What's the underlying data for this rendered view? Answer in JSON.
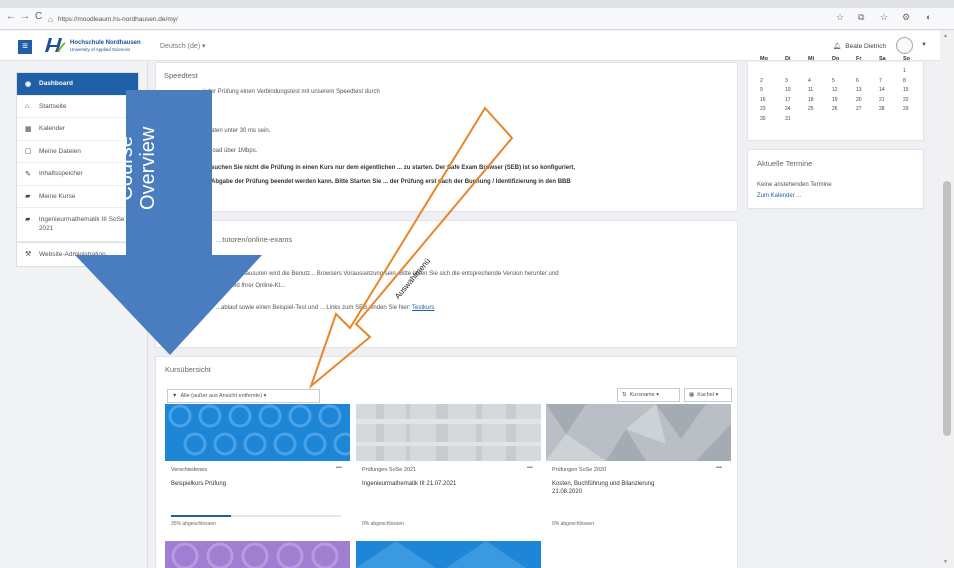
{
  "browser": {
    "url": "https://moodleaum.hs-nordhausen.de/my/"
  },
  "navbar": {
    "brand_line1": "Hochschule Nordhausen",
    "brand_line2": "University of Applied Sciences",
    "language": "Deutsch (de) ▾",
    "user_name": "Beate Dietrich"
  },
  "drawer": {
    "items": [
      {
        "label": "Dashboard",
        "icon": "dashboard-icon"
      },
      {
        "label": "Startseite",
        "icon": "home-icon"
      },
      {
        "label": "Kalender",
        "icon": "calendar-icon"
      },
      {
        "label": "Meine Dateien",
        "icon": "file-icon"
      },
      {
        "label": "Inhaltsspeicher",
        "icon": "pencil-icon"
      },
      {
        "label": "Meine Kurse",
        "icon": "graduation-cap-icon"
      },
      {
        "label": "Ingenieurmathematik III SoSe 2021",
        "icon": "graduation-cap-icon"
      }
    ],
    "admin_item": "Website-Administration"
  },
  "speedtest": {
    "title": "Speedtest",
    "line1": "... jeder Prüfung einen Verbindungstest mit unserem Speedtest durch",
    "line2": "...aten unter 30 ms sein.",
    "line3": "...load über 1Mbps.",
    "warn1": "...suchen Sie nicht die Prüfung in einen Kurs nur dem eigentlichen ... zu starten. Der Safe Exam Browser (SEB) ist so konfiguriert,",
    "warn2": "...Abgabe der Prüfung beendet werden kann. Bitte Starten Sie ... der Prüfung erst nach der Buchung / Identifizierung in den BBB"
  },
  "exams": {
    "title": "...tutoren/online-exams",
    "line1": "...Online-Klausuren wird die Benutz... Browsers Voraussetzung sein. Bitte laden Sie sich die entsprechende Version herunter und",
    "line2": "...Vorfeld Ihrer Online-Kl...",
    "line3": "...ablauf sowie einen Beispiel-Test und ... Links zum SEB, finden Sie hier:",
    "link": "Testkurs"
  },
  "calendar": {
    "headers": [
      "Mo",
      "Di",
      "Mi",
      "Do",
      "Fr",
      "Sa",
      "So"
    ],
    "rows": [
      [
        "",
        "",
        "",
        "",
        "",
        "",
        "1"
      ],
      [
        "2",
        "3",
        "4",
        "5",
        "6",
        "7",
        "8"
      ],
      [
        "9",
        "10",
        "11",
        "12",
        "13",
        "14",
        "15"
      ],
      [
        "16",
        "17",
        "18",
        "19",
        "20",
        "21",
        "22"
      ],
      [
        "23",
        "24",
        "25",
        "26",
        "27",
        "28",
        "29"
      ],
      [
        "30",
        "31",
        "",
        "",
        "",
        "",
        ""
      ]
    ]
  },
  "upcoming": {
    "title": "Aktuelle Termine",
    "empty": "Keine anstehenden Termine",
    "link": "Zum Kalender ..."
  },
  "overview": {
    "title": "Kursübersicht",
    "filter": "Alle (außer aus Ansicht entfernte) ▾",
    "sort": "Kursname ▾",
    "view": "Kachel ▾",
    "courses": [
      {
        "category": "Verschiedenes",
        "name": "Beispielkurs Prüfung",
        "progress_text": "35% abgeschlossen",
        "progress": 0.35,
        "color": "#1e86d6"
      },
      {
        "category": "Prüfungen SoSe 2021",
        "name": "Ingenieurmathematik III 21.07.2021",
        "progress_text": "0% abgeschlossen",
        "progress": 0,
        "color": "#d5d8dc"
      },
      {
        "category": "Prüfungen SoSe 2020",
        "name": "Kosten, Buchführung und Bilanzierung 21.08.2020",
        "progress_text": "0% abgeschlossen",
        "progress": 0,
        "color": "#b9bfc5"
      }
    ]
  },
  "annotations": {
    "course_overview_line1": "Course",
    "course_overview_line2": "Overview",
    "auswahl": "Auswahlmenü",
    "arrow_blue": "#4a7dc0",
    "arrow_orange": "#e8862a"
  }
}
